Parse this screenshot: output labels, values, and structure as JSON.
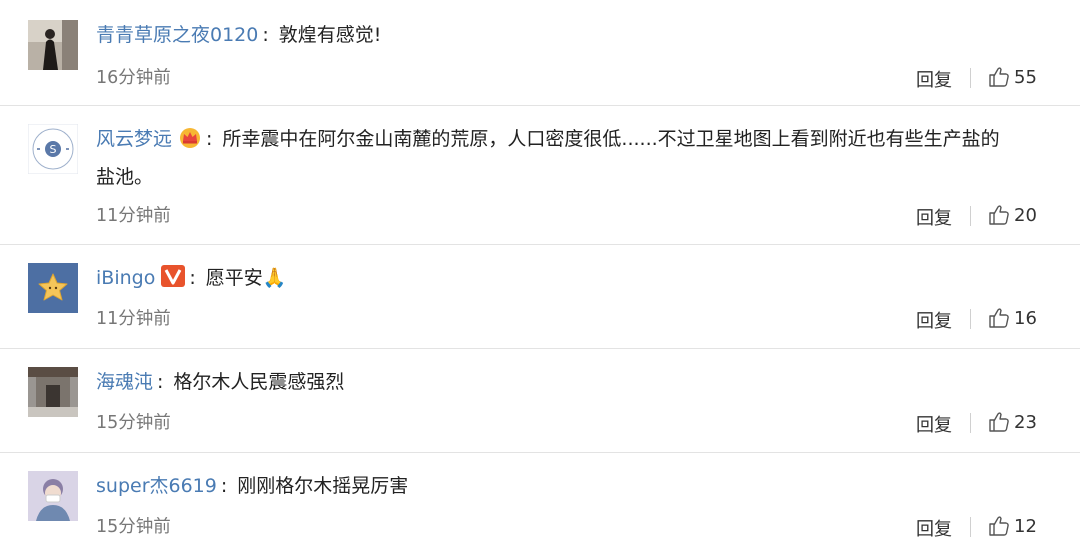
{
  "comments": [
    {
      "username": "青青草原之夜0120",
      "text": "敦煌有感觉!",
      "time": "16分钟前",
      "reply_label": "回复",
      "likes": "55",
      "badge": "none",
      "avatar_icon": "photo-avatar-person"
    },
    {
      "username": "风云梦远",
      "text": "所幸震中在阿尔金山南麓的荒原，人口密度很低......不过卫星地图上看到附近也有些生产盐的",
      "text2": "盐池。",
      "time": "11分钟前",
      "reply_label": "回复",
      "likes": "20",
      "badge": "crown-icon",
      "avatar_icon": "logo-avatar"
    },
    {
      "username": "iBingo",
      "text": "愿平安🙏",
      "time": "11分钟前",
      "reply_label": "回复",
      "likes": "16",
      "badge": "verified-v-icon",
      "avatar_icon": "star-avatar"
    },
    {
      "username": "海魂沌",
      "text": "格尔木人民震感强烈",
      "time": "15分钟前",
      "reply_label": "回复",
      "likes": "23",
      "badge": "none",
      "avatar_icon": "building-avatar"
    },
    {
      "username": "super杰6619",
      "text": "刚刚格尔木摇晃厉害",
      "time": "15分钟前",
      "reply_label": "回复",
      "likes": "12",
      "badge": "none",
      "avatar_icon": "person-avatar"
    }
  ],
  "colors": {
    "username": "#4a7bb3",
    "meta": "#777777",
    "divider": "#e3e3e3"
  }
}
